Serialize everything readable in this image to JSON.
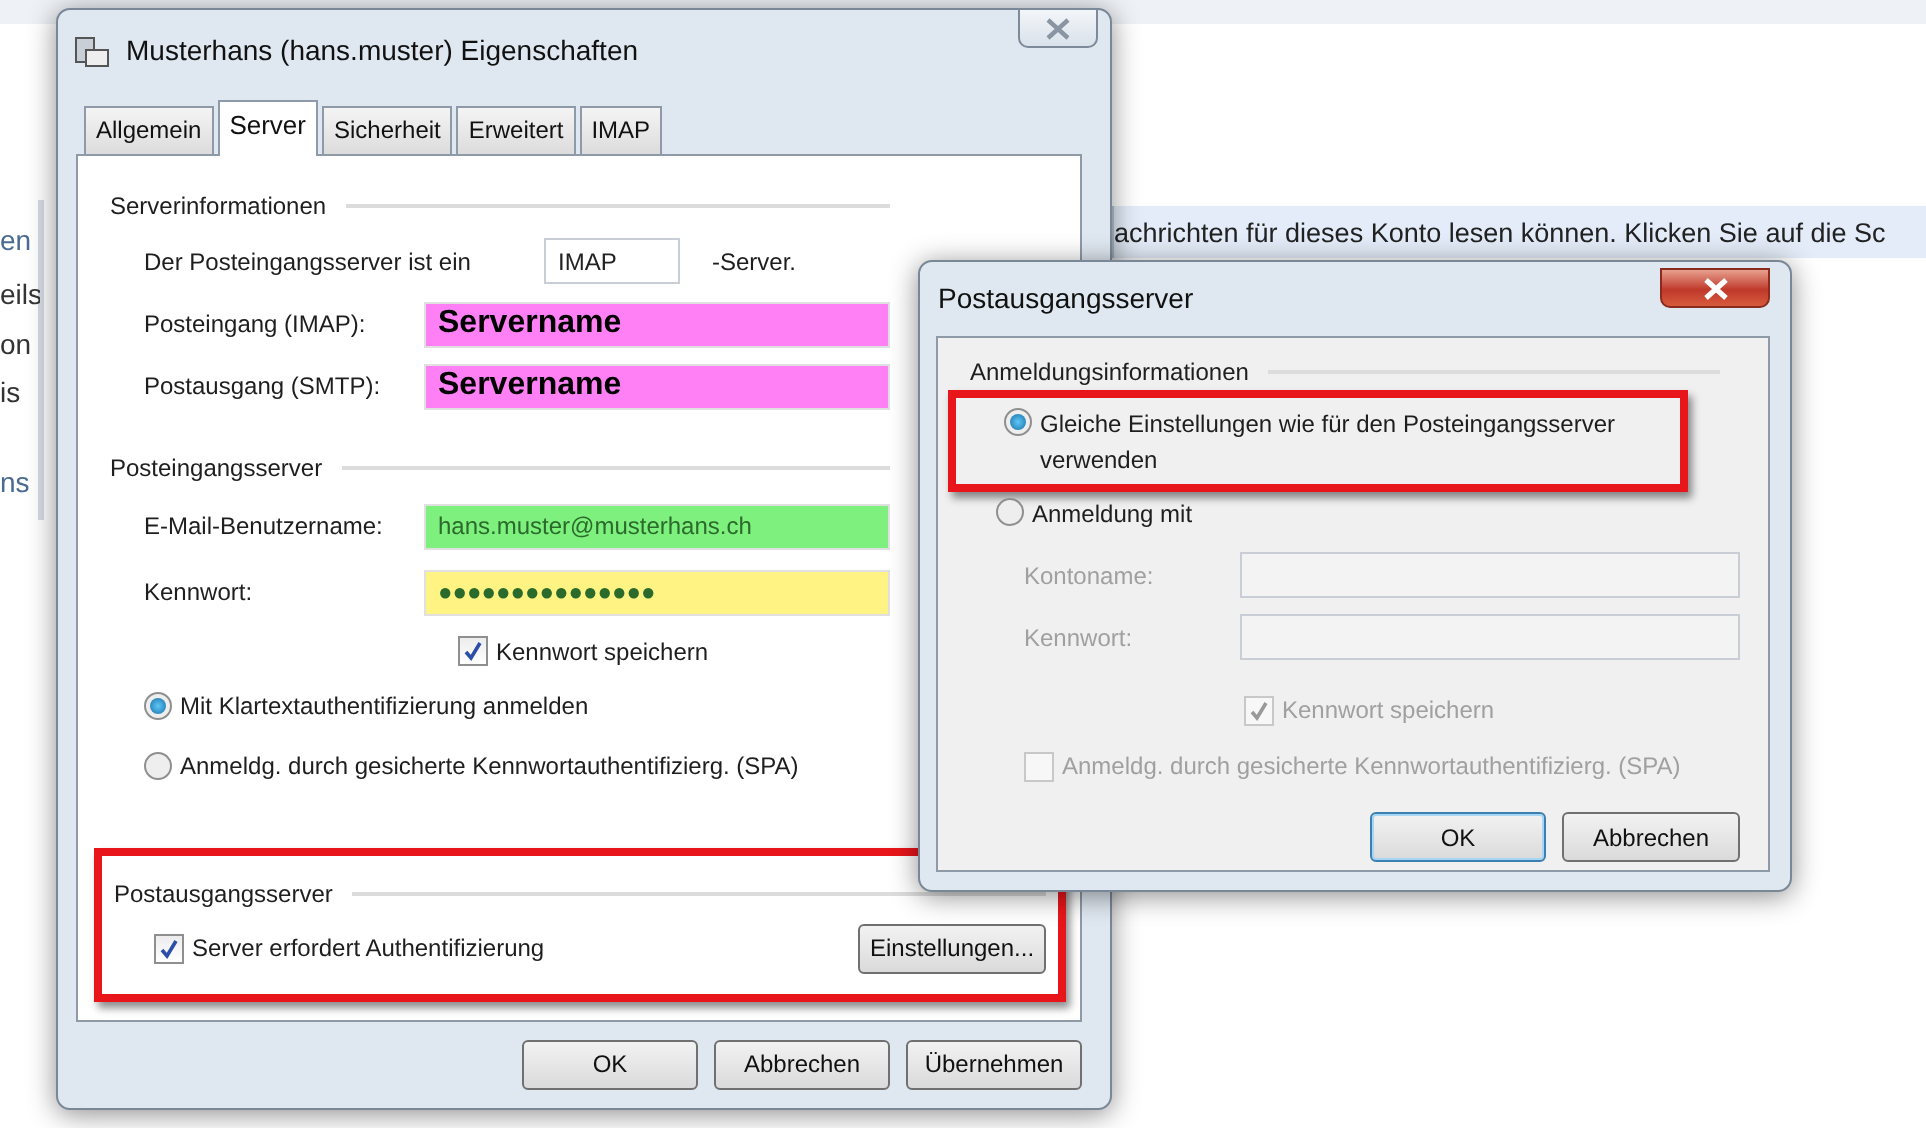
{
  "background": {
    "side_labels": [
      "en",
      "eils",
      "on",
      "is",
      "ns"
    ],
    "notice": "achrichten für dieses Konto lesen können. Klicken Sie auf die Sc"
  },
  "properties_dialog": {
    "title": "Musterhans (hans.muster) Eigenschaften",
    "tabs": [
      {
        "label": "Allgemein",
        "selected": false
      },
      {
        "label": "Server",
        "selected": true
      },
      {
        "label": "Sicherheit",
        "selected": false
      },
      {
        "label": "Erweitert",
        "selected": false
      },
      {
        "label": "IMAP",
        "selected": false
      }
    ],
    "server_info": {
      "heading": "Serverinformationen",
      "type_prefix": "Der Posteingangsserver ist ein",
      "type_value": "IMAP",
      "type_suffix": "-Server.",
      "fields": [
        {
          "label": "Posteingang (IMAP):",
          "value": "Servername",
          "color": "#ff80f4",
          "emphasized": true
        },
        {
          "label": "Postausgang (SMTP):",
          "value": "Servername",
          "color": "#ff80f4",
          "emphasized": true
        }
      ]
    },
    "incoming": {
      "heading": "Posteingangsserver",
      "fields": [
        {
          "label": "E-Mail-Benutzername:",
          "value": "hans.muster@musterhans.ch",
          "color": "#7ef07e",
          "emphasized": false
        },
        {
          "label": "Kennwort:",
          "value": "●●●●●●●●●●●●●●●",
          "color": "#fff383",
          "emphasized": false
        }
      ],
      "save_password": {
        "label": "Kennwort speichern",
        "checked": true
      },
      "auth_options": [
        {
          "label": "Mit Klartextauthentifizierung anmelden",
          "selected": true
        },
        {
          "label": "Anmeldg. durch gesicherte Kennwortauthentifizierg. (SPA)",
          "selected": false
        }
      ]
    },
    "outgoing": {
      "heading": "Postausgangsserver",
      "highlighted": true,
      "requires_auth": {
        "label": "Server erfordert Authentifizierung",
        "checked": true
      },
      "settings_button": "Einstellungen..."
    },
    "buttons": [
      "OK",
      "Abbrechen",
      "Übernehmen"
    ]
  },
  "outgoing_dialog": {
    "title": "Postausgangsserver",
    "heading": "Anmeldungsinformationen",
    "options": [
      {
        "label": "Gleiche Einstellungen wie für den Posteingangsserver verwenden",
        "selected": true,
        "highlighted": true
      },
      {
        "label": "Anmeldung mit",
        "selected": false,
        "highlighted": false
      }
    ],
    "fields": [
      {
        "label": "Kontoname:",
        "disabled": true
      },
      {
        "label": "Kennwort:",
        "disabled": true
      }
    ],
    "checkboxes": [
      {
        "label": "Kennwort speichern",
        "checked": true,
        "disabled": true
      },
      {
        "label": "Anmeldg. durch gesicherte Kennwortauthentifizierg. (SPA)",
        "checked": false,
        "disabled": true
      }
    ],
    "buttons": [
      {
        "label": "OK",
        "default": true
      },
      {
        "label": "Abbrechen",
        "default": false
      }
    ]
  }
}
